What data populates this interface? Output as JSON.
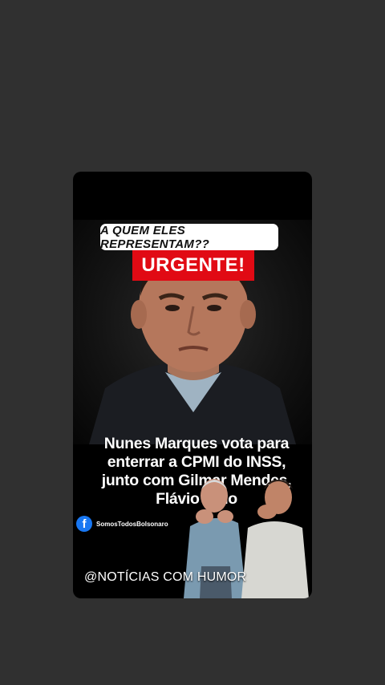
{
  "post": {
    "tagline": "A QUEM ELES REPRESENTAM??",
    "badge": "URGENTE!",
    "headline": {
      "line1": "Nunes Marques vota para",
      "line2": "enterrar a CPMI do INSS,",
      "line3": "junto com Gilmar Mendes,",
      "line4": "Flávio Dino"
    },
    "source_page": "SomosTodosBolsonaro",
    "watermark": "@NOTÍCIAS COM HUMOR"
  },
  "colors": {
    "page_background": "#303030",
    "card_background": "#000000",
    "badge_red": "#e10a14",
    "facebook_blue": "#1877f2"
  },
  "icons": {
    "source": "facebook-icon"
  }
}
